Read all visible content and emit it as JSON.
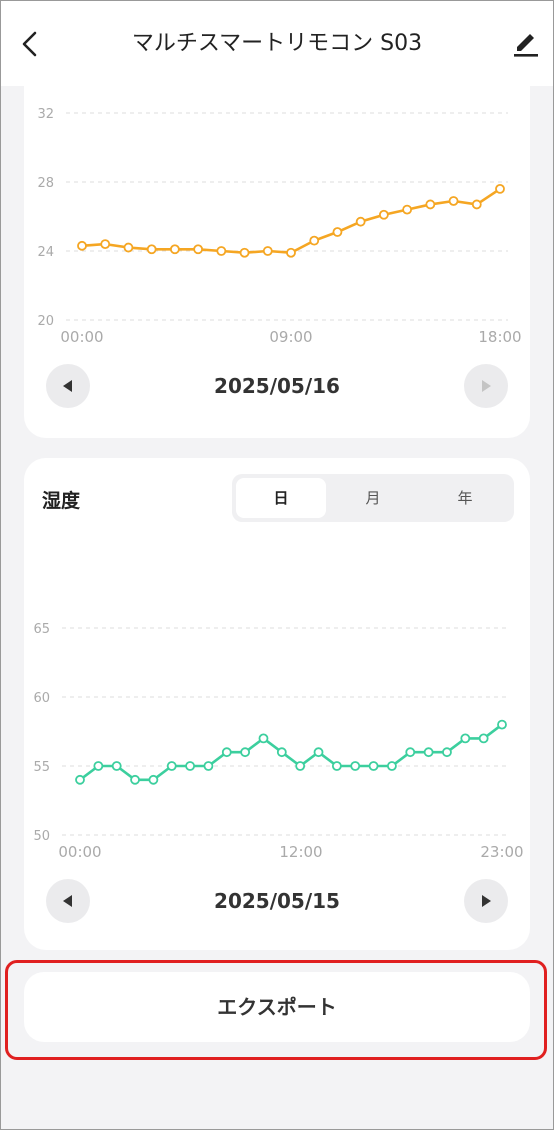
{
  "header": {
    "title": "マルチスマートリモコン S03"
  },
  "temperature_section": {
    "date": "2025/05/16"
  },
  "humidity_section": {
    "title": "湿度",
    "tabs": [
      "日",
      "月",
      "年"
    ],
    "active_tab": "日",
    "date": "2025/05/15"
  },
  "export_label": "エクスポート",
  "colors": {
    "temperature_line": "#f5a623",
    "humidity_line": "#3ccf9e",
    "grid": "#dddddd",
    "axis_text": "#aaaaaa"
  },
  "chart_data": [
    {
      "type": "line",
      "y_ticks": [
        20,
        24,
        28,
        32
      ],
      "ylim": [
        20,
        32
      ],
      "x_tick_labels": [
        "00:00",
        "09:00",
        "18:00"
      ],
      "x": [
        "00:00",
        "01:00",
        "02:00",
        "03:00",
        "04:00",
        "05:00",
        "06:00",
        "07:00",
        "08:00",
        "09:00",
        "10:00",
        "11:00",
        "12:00",
        "13:00",
        "14:00",
        "15:00",
        "16:00",
        "17:00",
        "18:00"
      ],
      "series": [
        {
          "values": [
            24.3,
            24.4,
            24.2,
            24.1,
            24.1,
            24.1,
            24.0,
            23.9,
            24.0,
            23.9,
            24.6,
            25.1,
            25.7,
            26.1,
            26.4,
            26.7,
            26.9,
            26.7,
            27.6
          ]
        }
      ],
      "grid": true
    },
    {
      "type": "line",
      "y_ticks": [
        50,
        55,
        60,
        65
      ],
      "ylim": [
        50,
        65
      ],
      "x_tick_labels": [
        "00:00",
        "12:00",
        "23:00"
      ],
      "x": [
        "00:00",
        "01:00",
        "02:00",
        "03:00",
        "04:00",
        "05:00",
        "06:00",
        "07:00",
        "08:00",
        "09:00",
        "10:00",
        "11:00",
        "12:00",
        "13:00",
        "14:00",
        "15:00",
        "16:00",
        "17:00",
        "18:00",
        "19:00",
        "20:00",
        "21:00",
        "22:00",
        "23:00"
      ],
      "series": [
        {
          "values": [
            54,
            55,
            55,
            54,
            54,
            55,
            55,
            55,
            56,
            56,
            57,
            56,
            55,
            56,
            55,
            55,
            55,
            55,
            56,
            56,
            56,
            57,
            57,
            58
          ]
        }
      ],
      "grid": true
    }
  ]
}
